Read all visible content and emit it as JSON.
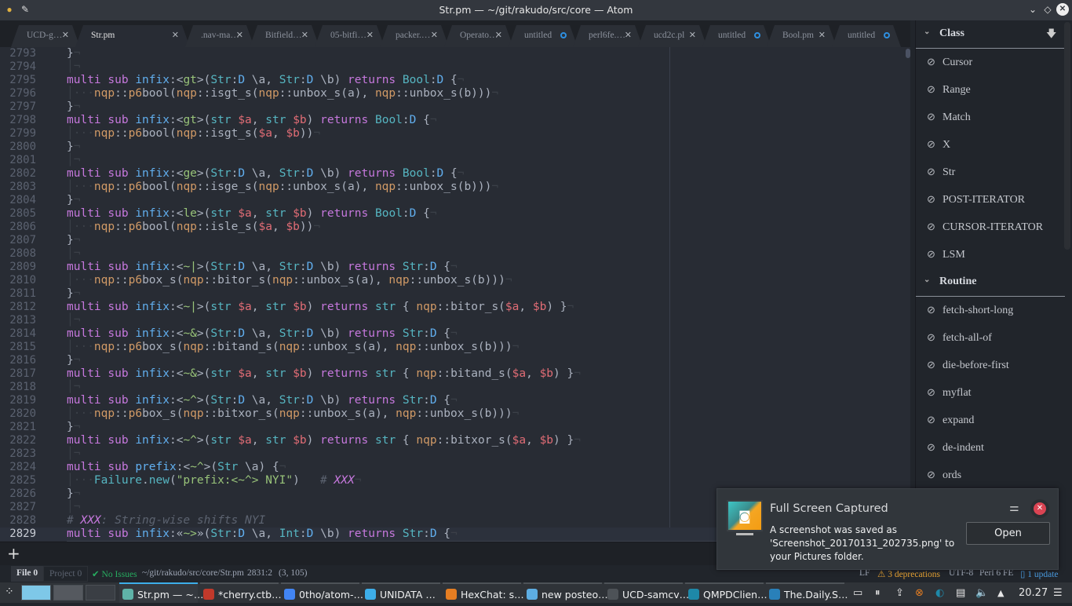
{
  "window": {
    "title": "Str.pm — ~/git/rakudo/src/core — Atom",
    "controls": [
      "minimize-icon",
      "maximize-icon",
      "close-icon"
    ]
  },
  "tabs": [
    {
      "label": "UCD-g…",
      "state": "close"
    },
    {
      "label": "Str.pm",
      "state": "close",
      "active": true
    },
    {
      "label": ".nav-ma…",
      "state": "close"
    },
    {
      "label": "Bitfield…",
      "state": "close"
    },
    {
      "label": "05-bitfi…",
      "state": "close"
    },
    {
      "label": "packer.…",
      "state": "close"
    },
    {
      "label": "Operato…",
      "state": "close"
    },
    {
      "label": "untitled",
      "state": "modified"
    },
    {
      "label": "perl6fe.…",
      "state": "close"
    },
    {
      "label": "ucd2c.pl",
      "state": "close"
    },
    {
      "label": "untitled",
      "state": "modified"
    },
    {
      "label": "Bool.pm",
      "state": "close"
    },
    {
      "label": "untitled",
      "state": "modified"
    }
  ],
  "editor": {
    "current_line": "2829",
    "lines": [
      {
        "n": "2793",
        "text": "}"
      },
      {
        "n": "2794",
        "text": ""
      },
      {
        "n": "2795",
        "text": "multi sub infix:<gt>(Str:D \\a, Str:D \\b) returns Bool:D {"
      },
      {
        "n": "2796",
        "text": "    nqp::p6bool(nqp::isgt_s(nqp::unbox_s(a), nqp::unbox_s(b)))"
      },
      {
        "n": "2797",
        "text": "}"
      },
      {
        "n": "2798",
        "text": "multi sub infix:<gt>(str $a, str $b) returns Bool:D {"
      },
      {
        "n": "2799",
        "text": "    nqp::p6bool(nqp::isgt_s($a, $b))"
      },
      {
        "n": "2800",
        "text": "}"
      },
      {
        "n": "2801",
        "text": ""
      },
      {
        "n": "2802",
        "text": "multi sub infix:<ge>(Str:D \\a, Str:D \\b) returns Bool:D {"
      },
      {
        "n": "2803",
        "text": "    nqp::p6bool(nqp::isge_s(nqp::unbox_s(a), nqp::unbox_s(b)))"
      },
      {
        "n": "2804",
        "text": "}"
      },
      {
        "n": "2805",
        "text": "multi sub infix:<le>(str $a, str $b) returns Bool:D {"
      },
      {
        "n": "2806",
        "text": "    nqp::p6bool(nqp::isle_s($a, $b))"
      },
      {
        "n": "2807",
        "text": "}"
      },
      {
        "n": "2808",
        "text": ""
      },
      {
        "n": "2809",
        "text": "multi sub infix:<~|>(Str:D \\a, Str:D \\b) returns Str:D {"
      },
      {
        "n": "2810",
        "text": "    nqp::p6box_s(nqp::bitor_s(nqp::unbox_s(a), nqp::unbox_s(b)))"
      },
      {
        "n": "2811",
        "text": "}"
      },
      {
        "n": "2812",
        "text": "multi sub infix:<~|>(str $a, str $b) returns str { nqp::bitor_s($a, $b) }"
      },
      {
        "n": "2813",
        "text": ""
      },
      {
        "n": "2814",
        "text": "multi sub infix:<~&>(Str:D \\a, Str:D \\b) returns Str:D {"
      },
      {
        "n": "2815",
        "text": "    nqp::p6box_s(nqp::bitand_s(nqp::unbox_s(a), nqp::unbox_s(b)))"
      },
      {
        "n": "2816",
        "text": "}"
      },
      {
        "n": "2817",
        "text": "multi sub infix:<~&>(str $a, str $b) returns str { nqp::bitand_s($a, $b) }"
      },
      {
        "n": "2818",
        "text": ""
      },
      {
        "n": "2819",
        "text": "multi sub infix:<~^>(Str:D \\a, Str:D \\b) returns Str:D {"
      },
      {
        "n": "2820",
        "text": "    nqp::p6box_s(nqp::bitxor_s(nqp::unbox_s(a), nqp::unbox_s(b)))"
      },
      {
        "n": "2821",
        "text": "}"
      },
      {
        "n": "2822",
        "text": "multi sub infix:<~^>(str $a, str $b) returns str { nqp::bitxor_s($a, $b) }"
      },
      {
        "n": "2823",
        "text": ""
      },
      {
        "n": "2824",
        "text": "multi sub prefix:<~^>(Str \\a) {"
      },
      {
        "n": "2825",
        "text": "    Failure.new(\"prefix:<~^> NYI\")   # XXX"
      },
      {
        "n": "2826",
        "text": "}"
      },
      {
        "n": "2827",
        "text": ""
      },
      {
        "n": "2828",
        "text": "# XXX: String-wise shifts NYI"
      },
      {
        "n": "2829",
        "text": "multi sub infix:«~>»(Str:D \\a, Int:D \\b) returns Str:D {"
      }
    ]
  },
  "panel": {
    "add_label": "+"
  },
  "statusbar": {
    "file_tab": "File",
    "file_count": "0",
    "project_tab": "Project",
    "project_count": "0",
    "issues": "No Issues",
    "path": "~/git/rakudo/src/core/Str.pm",
    "cursor": "2831:2",
    "selection": "(3, 105)",
    "line_ending": "LF",
    "deprecations": "3 deprecations",
    "encoding": "UTF-8",
    "grammar": "Perl 6 FE",
    "updates": "1 update"
  },
  "outline": {
    "sections": [
      {
        "title": "Class",
        "items": [
          "Cursor",
          "Range",
          "Match",
          "X",
          "Str",
          "POST-ITERATOR",
          "CURSOR-ITERATOR",
          "LSM"
        ]
      },
      {
        "title": "Routine",
        "items": [
          "fetch-short-long",
          "fetch-all-of",
          "die-before-first",
          "myflat",
          "expand",
          "de-indent",
          "ords"
        ]
      }
    ]
  },
  "notification": {
    "title": "Full Screen Captured",
    "body": "A screenshot was saved as 'Screenshot_20170131_202735.png' to your Pictures folder.",
    "open_label": "Open"
  },
  "taskbar": {
    "tasks": [
      {
        "label": "Str.pm — ~…",
        "color": "#5fb3a8",
        "active": true
      },
      {
        "label": "*cherry.ctb…",
        "color": "#c0392b"
      },
      {
        "label": "0tho/atom-…",
        "color": "#4285f4"
      },
      {
        "label": "UNIDATA …",
        "color": "#3daee9"
      },
      {
        "label": "HexChat: s…",
        "color": "#e67e22"
      },
      {
        "label": "new posteo…",
        "color": "#5dade2"
      },
      {
        "label": "UCD-samcv…",
        "color": "#4d5257"
      },
      {
        "label": "QMPDClien…",
        "color": "#1e88a8"
      },
      {
        "label": "The.Daily.S…",
        "color": "#2980b9"
      }
    ],
    "clock": "20.27"
  }
}
